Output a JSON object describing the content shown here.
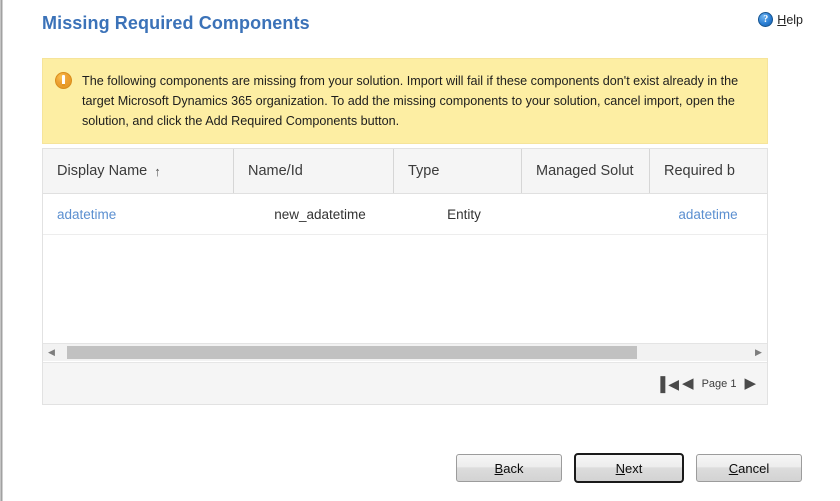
{
  "window": {
    "title": "Missing Required Components"
  },
  "header": {
    "title": "Missing Required Components",
    "help": {
      "icon": "help-circle-icon",
      "accesskey": "H",
      "rest": "elp"
    }
  },
  "warning": {
    "icon": "warning-exclamation-icon",
    "message": "The following components are missing from your solution. Import will fail if these components don't exist already in the target Microsoft Dynamics 365 organization. To add the missing components to your solution, cancel import, open the solution, and click the Add Required Components button.",
    "background_color": "#fdeea3",
    "icon_color": "#e2951f"
  },
  "grid": {
    "columns": [
      {
        "label": "Display Name",
        "sorted": true,
        "sort_icon": "sort-ascending-arrow",
        "sort_glyph": "↑"
      },
      {
        "label": "Name/Id",
        "sorted": false,
        "sort_glyph": ""
      },
      {
        "label": "Type",
        "sorted": false,
        "sort_glyph": ""
      },
      {
        "label": "Managed Solut",
        "sorted": false,
        "sort_glyph": ""
      },
      {
        "label": "Required b",
        "sorted": false,
        "sort_glyph": ""
      }
    ],
    "rows": [
      {
        "display_name": "adatetime",
        "name_id": "new_adatetime",
        "type": "Entity",
        "managed_solution": "",
        "required_by": "adatetime"
      }
    ],
    "link_color": "#5b8fd0",
    "scrollbar": {
      "left_arrow": "scroll-left-arrow",
      "right_arrow": "scroll-right-arrow",
      "left_glyph": "◀",
      "right_glyph": "▶"
    },
    "pager": {
      "first_glyph": "◀",
      "prev_glyph": "◀",
      "next_glyph": "▶",
      "page_label": "Page 1"
    }
  },
  "footer": {
    "buttons": [
      {
        "name": "back",
        "accesskey": "B",
        "rest": "ack",
        "default": false
      },
      {
        "name": "next",
        "accesskey": "N",
        "rest": "ext",
        "default": true
      },
      {
        "name": "cancel",
        "accesskey": "C",
        "rest": "ancel",
        "default": false
      }
    ]
  }
}
